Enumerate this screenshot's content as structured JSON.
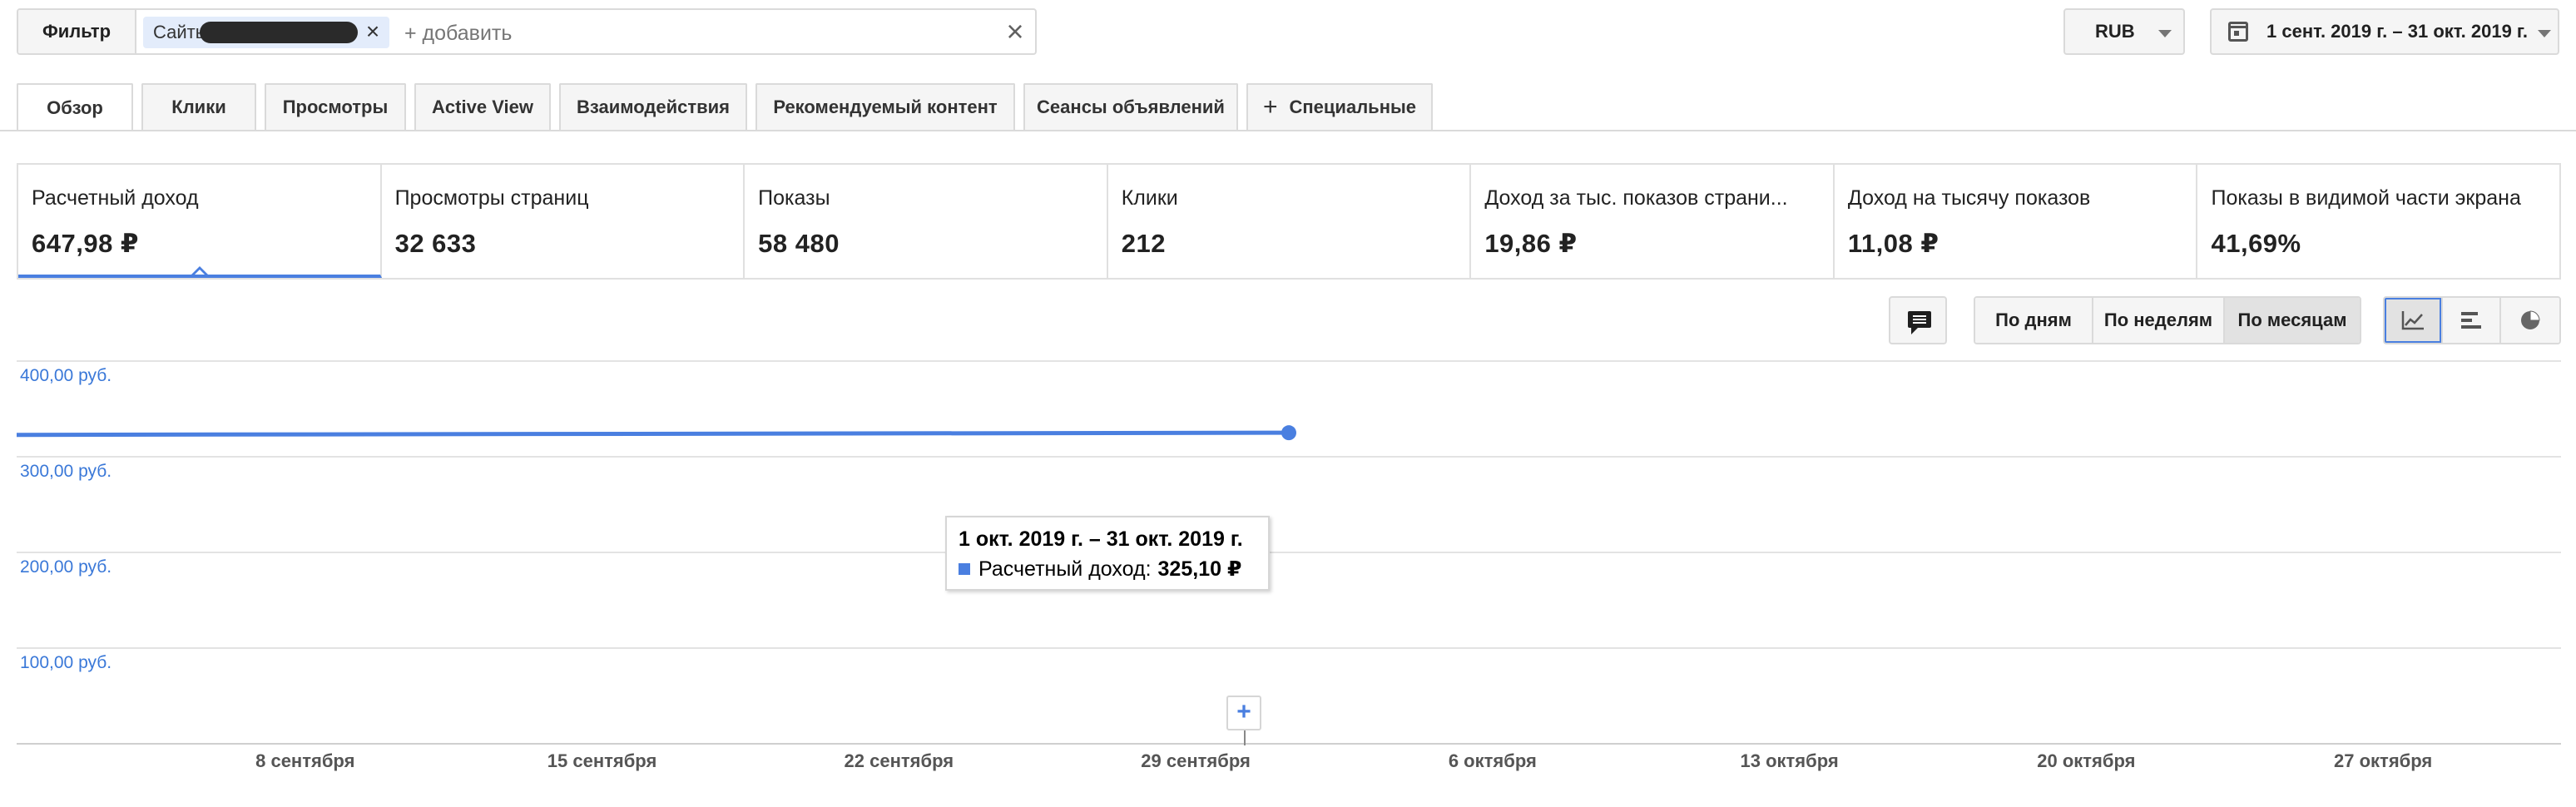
{
  "filter": {
    "button_label": "Фильтр",
    "chip_label": "Сайты",
    "input_placeholder": "+ добавить"
  },
  "currency": {
    "value": "RUB"
  },
  "date_range": {
    "value": "1 сент. 2019 г. – 31 окт. 2019 г."
  },
  "tabs": [
    {
      "label": "Обзор",
      "active": true
    },
    {
      "label": "Клики"
    },
    {
      "label": "Просмотры"
    },
    {
      "label": "Active View"
    },
    {
      "label": "Взаимодействия"
    },
    {
      "label": "Рекомендуемый контент"
    },
    {
      "label": "Сеансы объявлений"
    },
    {
      "label": "Специальные"
    }
  ],
  "metrics": [
    {
      "label": "Расчетный доход",
      "value": "647,98 ₽",
      "active": true
    },
    {
      "label": "Просмотры страниц",
      "value": "32 633"
    },
    {
      "label": "Показы",
      "value": "58 480"
    },
    {
      "label": "Клики",
      "value": "212"
    },
    {
      "label": "Доход за тыс. показов страни...",
      "value": "19,86 ₽"
    },
    {
      "label": "Доход на тысячу показов",
      "value": "11,08 ₽"
    },
    {
      "label": "Показы в видимой части экрана",
      "value": "41,69%"
    }
  ],
  "period_buttons": [
    {
      "label": "По дням"
    },
    {
      "label": "По неделям"
    },
    {
      "label": "По месяцам",
      "selected": true
    }
  ],
  "view_buttons": [
    "line-chart-icon",
    "bar-chart-icon",
    "pie-chart-icon"
  ],
  "chart_data": {
    "type": "line",
    "series": [
      {
        "name": "Расчетный доход",
        "color": "#4a7fe0",
        "points": [
          {
            "x": "2019-09-01",
            "y": 322.88
          },
          {
            "x": "2019-10-01",
            "y": 325.1
          }
        ]
      }
    ],
    "y_ticks": [
      "400,00 руб.",
      "300,00 руб.",
      "200,00 руб.",
      "100,00 руб."
    ],
    "y_tick_values": [
      400,
      300,
      200,
      100
    ],
    "ylim": [
      0,
      400
    ],
    "x_ticks": [
      "8 сентября",
      "15 сентября",
      "22 сентября",
      "29 сентября",
      "6 октября",
      "13 октября",
      "20 октября",
      "27 октября"
    ],
    "x_tick_dates": [
      "2019-09-08",
      "2019-09-15",
      "2019-09-22",
      "2019-09-29",
      "2019-10-06",
      "2019-10-13",
      "2019-10-20",
      "2019-10-27"
    ],
    "xlim": [
      "2019-09-01",
      "2019-10-31"
    ],
    "grid": true,
    "tooltip": {
      "title": "1 окт. 2019 г. – 31 окт. 2019 г.",
      "label": "Расчетный доход:",
      "value": "325,10 ₽"
    }
  }
}
